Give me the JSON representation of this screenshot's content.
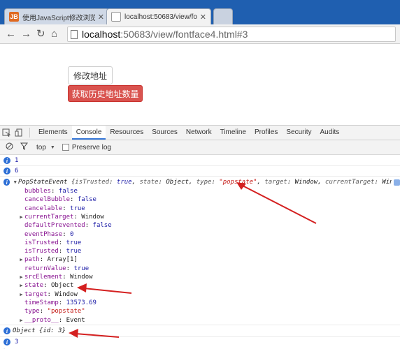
{
  "tabs": [
    {
      "title": "使用JavaScript修改浏览器",
      "favicon": "JB"
    },
    {
      "title": "localhost:50683/view/fo",
      "favicon": ""
    }
  ],
  "address": {
    "host": "localhost",
    "path": ":50683/view/fontface4.html#3"
  },
  "page": {
    "modify_button": "修改地址",
    "history_button": "获取历史地址数量"
  },
  "devtools": {
    "tabs": [
      "Elements",
      "Console",
      "Resources",
      "Sources",
      "Network",
      "Timeline",
      "Profiles",
      "Security",
      "Audits"
    ],
    "active_tab": "Console",
    "filter_context": "top",
    "preserve_log": "Preserve log"
  },
  "console": {
    "line1": "1",
    "line2": "6",
    "event_head": {
      "name": "PopStateEvent",
      "open": " {",
      "isTrusted_k": "isTrusted",
      "isTrusted_v": "true",
      "state_k": "state",
      "state_v": "Object",
      "type_k": "type",
      "type_v": "\"popstate\"",
      "target_k": "target",
      "target_v": "Window",
      "current_k": "currentTarget",
      "current_v": "Window…}"
    },
    "props": [
      {
        "key": "bubbles",
        "value": "false",
        "kind": "kw",
        "expand": false
      },
      {
        "key": "cancelBubble",
        "value": "false",
        "kind": "kw",
        "expand": false
      },
      {
        "key": "cancelable",
        "value": "true",
        "kind": "kw",
        "expand": false
      },
      {
        "key": "currentTarget",
        "value": "Window",
        "kind": "plain",
        "expand": true
      },
      {
        "key": "defaultPrevented",
        "value": "false",
        "kind": "kw",
        "expand": false
      },
      {
        "key": "eventPhase",
        "value": "0",
        "kind": "kw",
        "expand": false
      },
      {
        "key": "isTrusted",
        "value": "true",
        "kind": "kw",
        "expand": false
      },
      {
        "key": "isTrusted",
        "value": "true",
        "kind": "kw",
        "expand": false
      },
      {
        "key": "path",
        "value": "Array[1]",
        "kind": "plain",
        "expand": true
      },
      {
        "key": "returnValue",
        "value": "true",
        "kind": "kw",
        "expand": false
      },
      {
        "key": "srcElement",
        "value": "Window",
        "kind": "plain",
        "expand": true
      },
      {
        "key": "state",
        "value": "Object",
        "kind": "plain",
        "expand": true
      },
      {
        "key": "target",
        "value": "Window",
        "kind": "plain",
        "expand": true
      },
      {
        "key": "timeStamp",
        "value": "13573.69",
        "kind": "kw",
        "expand": false
      },
      {
        "key": "type",
        "value": "\"popstate\"",
        "kind": "str",
        "expand": false
      },
      {
        "key": "__proto__",
        "value": "Event",
        "kind": "plain",
        "expand": true
      }
    ],
    "object_line": "Object {id: 3}",
    "line_last": "3"
  },
  "colors": {
    "accent_red": "#d9534f",
    "arrow_red": "#d42020",
    "info_blue": "#2d6fd6"
  }
}
